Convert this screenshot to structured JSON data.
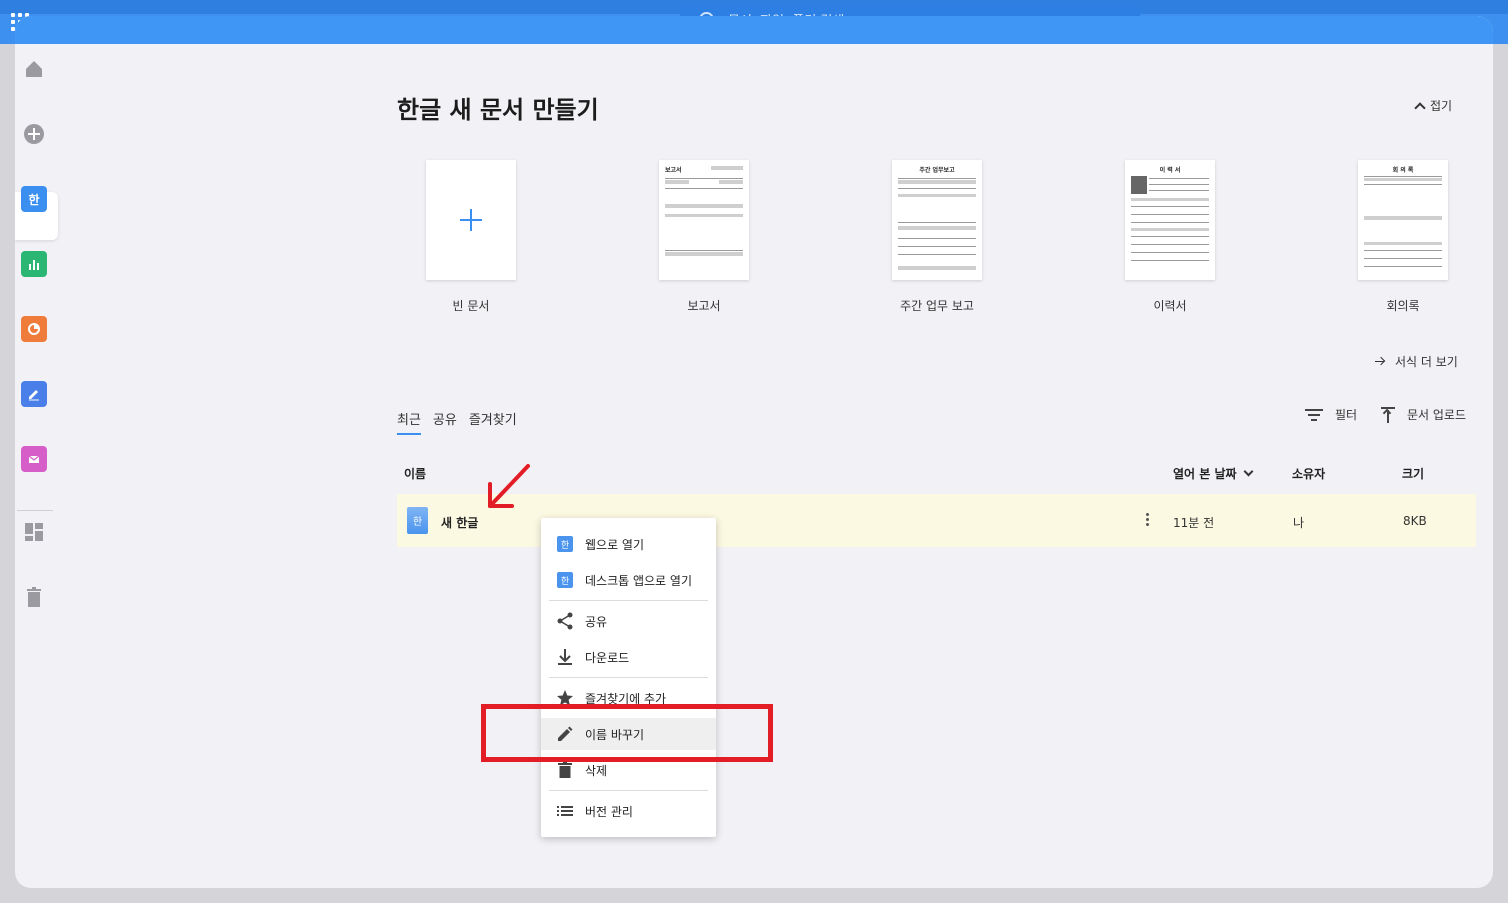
{
  "search": {
    "placeholder": "문서, 파일, 폴더 검색"
  },
  "sidebar": {
    "items": [
      {
        "name": "home-icon"
      },
      {
        "name": "add-icon"
      },
      {
        "name": "hangul-app-icon",
        "glyph": "한",
        "color": "#3b8ff0"
      },
      {
        "name": "sheet-app-icon",
        "color": "#2bb673"
      },
      {
        "name": "slide-app-icon",
        "color": "#f07c3b"
      },
      {
        "name": "edit-app-icon",
        "color": "#4a7ee8"
      },
      {
        "name": "mail-app-icon",
        "color": "#d65ec9"
      },
      {
        "name": "dashboard-icon"
      },
      {
        "name": "trash-icon"
      }
    ]
  },
  "create": {
    "title": "한글 새 문서 만들기",
    "collapse_label": "접기",
    "templates": [
      {
        "label": "빈 문서",
        "header": ""
      },
      {
        "label": "보고서",
        "header": "보고서"
      },
      {
        "label": "주간 업무 보고",
        "header": "주간 업무보고"
      },
      {
        "label": "이력서",
        "header": "이 력 서"
      },
      {
        "label": "회의록",
        "header": "회 의 록"
      }
    ],
    "more_label": "서식 더 보기"
  },
  "tabs": [
    {
      "label": "최근",
      "active": true
    },
    {
      "label": "공유",
      "active": false
    },
    {
      "label": "즐겨찾기",
      "active": false
    }
  ],
  "toolbar": {
    "filter_label": "필터",
    "upload_label": "문서 업로드"
  },
  "table": {
    "headers": {
      "name": "이름",
      "opened": "열어 본 날짜",
      "owner": "소유자",
      "size": "크기"
    },
    "rows": [
      {
        "name": "새 한글",
        "icon_glyph": "한",
        "opened": "11분 전",
        "owner": "나",
        "size": "8KB"
      }
    ]
  },
  "context_menu": {
    "items": [
      {
        "label": "웹으로 열기",
        "icon": "hangul-tile-icon"
      },
      {
        "label": "데스크톱 앱으로 열기",
        "icon": "hangul-tile-icon"
      },
      {
        "label": "공유",
        "icon": "share-icon"
      },
      {
        "label": "다운로드",
        "icon": "download-icon"
      },
      {
        "label": "즐겨찾기에 추가",
        "icon": "star-icon"
      },
      {
        "label": "이름 바꾸기",
        "icon": "pencil-icon"
      },
      {
        "label": "삭제",
        "icon": "trash-icon"
      },
      {
        "label": "버전 관리",
        "icon": "list-icon"
      }
    ]
  },
  "colors": {
    "accent": "#3b8ff0",
    "highlight_row": "#fbf9e2",
    "annotation": "#e31d26"
  }
}
